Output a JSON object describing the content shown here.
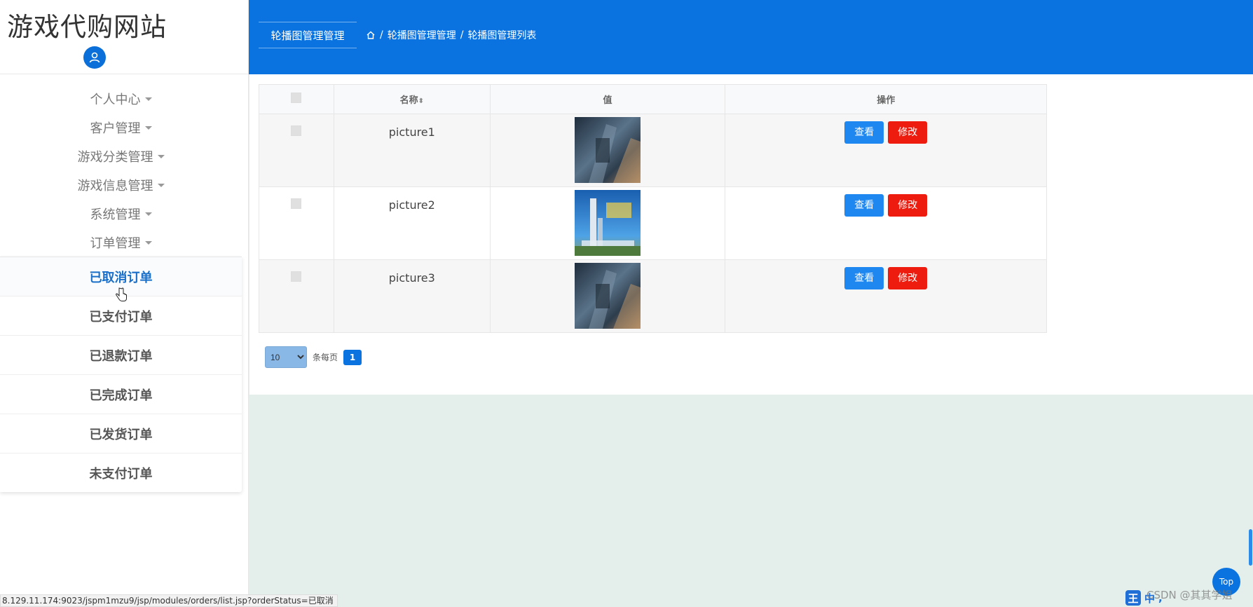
{
  "site": {
    "title": "游戏代购网站"
  },
  "sidebar": {
    "menu": [
      {
        "label": "个人中心"
      },
      {
        "label": "客户管理"
      },
      {
        "label": "游戏分类管理"
      },
      {
        "label": "游戏信息管理"
      },
      {
        "label": "系统管理"
      },
      {
        "label": "订单管理"
      }
    ],
    "submenu": [
      {
        "label": "已取消订单",
        "active": true
      },
      {
        "label": "已支付订单"
      },
      {
        "label": "已退款订单"
      },
      {
        "label": "已完成订单"
      },
      {
        "label": "已发货订单"
      },
      {
        "label": "未支付订单"
      }
    ]
  },
  "header": {
    "tab": "轮播图管理管理",
    "breadcrumb": [
      "轮播图管理管理",
      "轮播图管理列表"
    ],
    "separator": "/"
  },
  "table": {
    "columns": [
      "名称",
      "值",
      "操作"
    ],
    "sort_indicator": "⬍",
    "rows": [
      {
        "name": "picture1",
        "image": "blurred-photo-icon"
      },
      {
        "name": "picture2",
        "image": "tower-photo-icon"
      },
      {
        "name": "picture3",
        "image": "blurred-photo-icon"
      }
    ],
    "actions": {
      "view": "查看",
      "edit": "修改"
    }
  },
  "pager": {
    "page_size": "10",
    "per_page_label": "条每页",
    "current_page": "1"
  },
  "status": {
    "url": "8.129.11.174:9023/jspm1mzu9/jsp/modules/orders/list.jsp?orderStatus=已取消"
  },
  "overlay": {
    "top_button": "Top",
    "watermark": "CSDN @其其学姐"
  },
  "colors": {
    "primary": "#0a73e0",
    "view_button": "#1e88f0",
    "edit_button": "#ee1c0f",
    "background": "#e4efec"
  }
}
